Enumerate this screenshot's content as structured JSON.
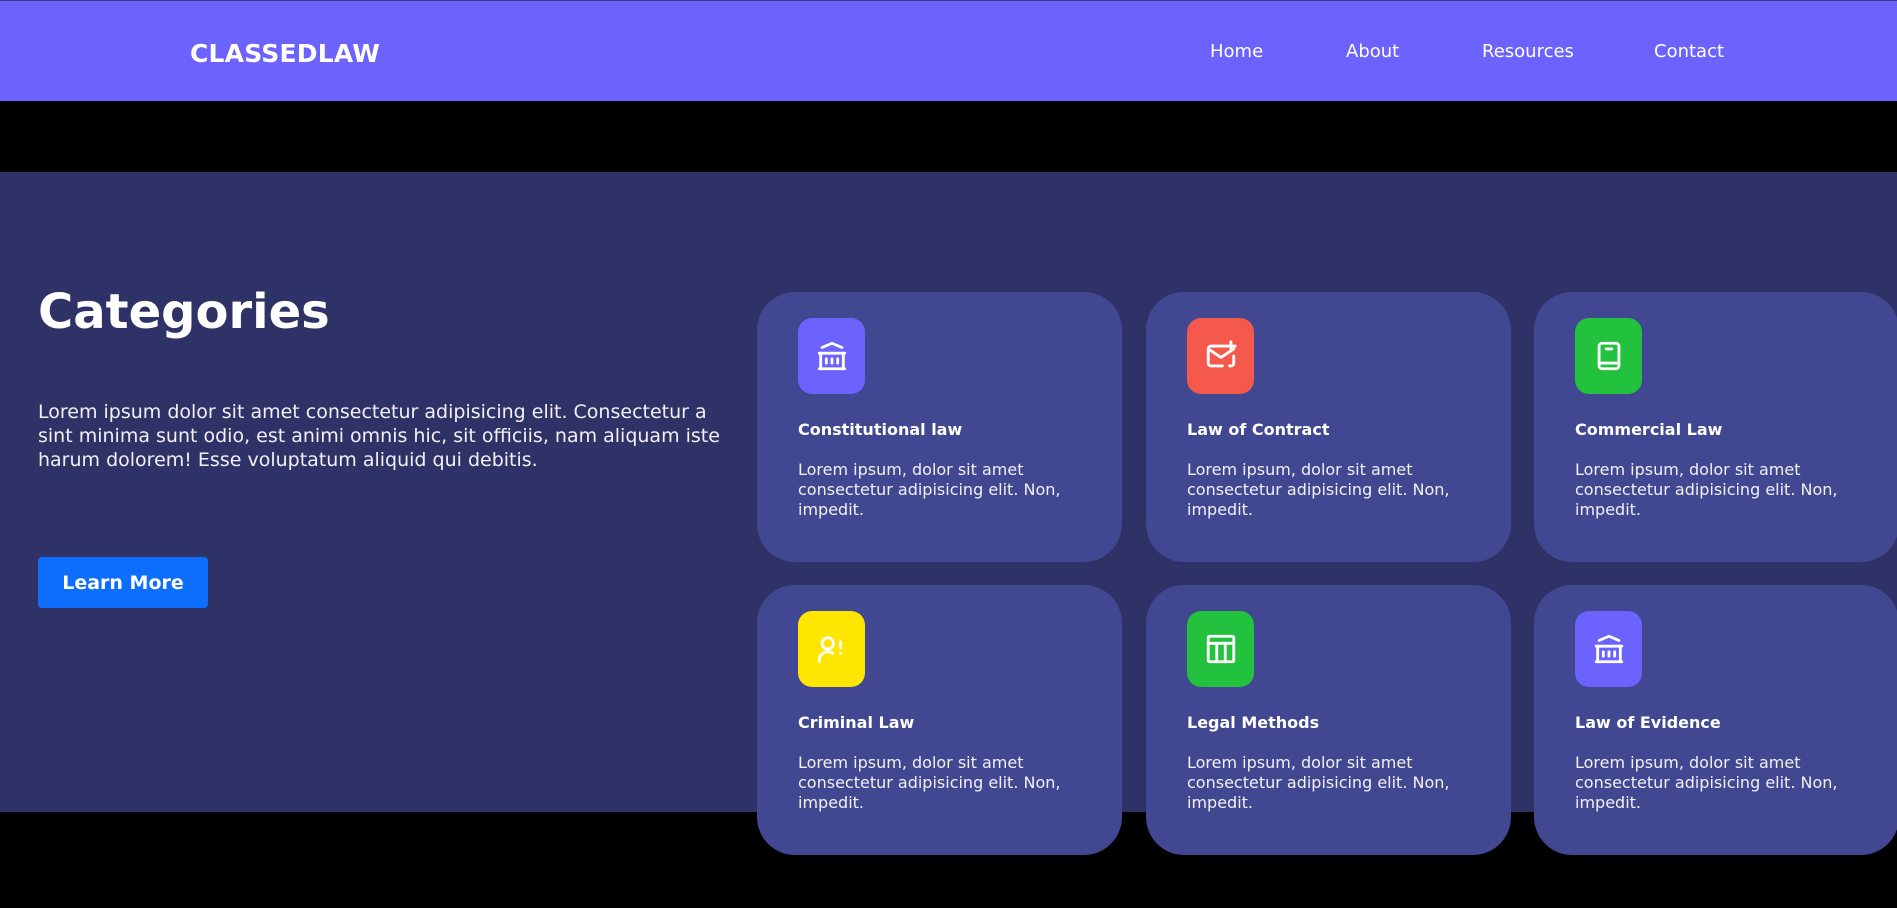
{
  "header": {
    "logo": "CLASSEDLAW",
    "nav": [
      "Home",
      "About",
      "Resources",
      "Contact"
    ]
  },
  "section": {
    "title": "Categories",
    "description": "Lorem ipsum dolor sit amet consectetur adipisicing elit. Consectetur a sint minima sunt odio, est animi omnis hic, sit officiis, nam aliquam iste harum dolorem! Esse voluptatum aliquid qui debitis.",
    "button": "Learn More"
  },
  "cards": [
    {
      "title": "Constitutional law",
      "text": "Lorem ipsum, dolor sit amet consectetur adipisicing elit. Non, impedit.",
      "icon": "bank-icon",
      "color": "#6c63ff"
    },
    {
      "title": "Law of Contract",
      "text": "Lorem ipsum, dolor sit amet consectetur adipisicing elit. Non, impedit.",
      "icon": "mail-plus-icon",
      "color": "#f5594c"
    },
    {
      "title": "Commercial Law",
      "text": "Lorem ipsum, dolor sit amet consectetur adipisicing elit. Non, impedit.",
      "icon": "book-icon",
      "color": "#22c13e"
    },
    {
      "title": "Criminal Law",
      "text": "Lorem ipsum, dolor sit amet consectetur adipisicing elit. Non, impedit.",
      "icon": "user-alert-icon",
      "color": "#ffe600"
    },
    {
      "title": "Legal Methods",
      "text": "Lorem ipsum, dolor sit amet consectetur adipisicing elit. Non, impedit.",
      "icon": "layout-icon",
      "color": "#22c13e"
    },
    {
      "title": "Law of Evidence",
      "text": "Lorem ipsum, dolor sit amet consectetur adipisicing elit. Non, impedit.",
      "icon": "bank-icon",
      "color": "#6c63ff"
    }
  ]
}
